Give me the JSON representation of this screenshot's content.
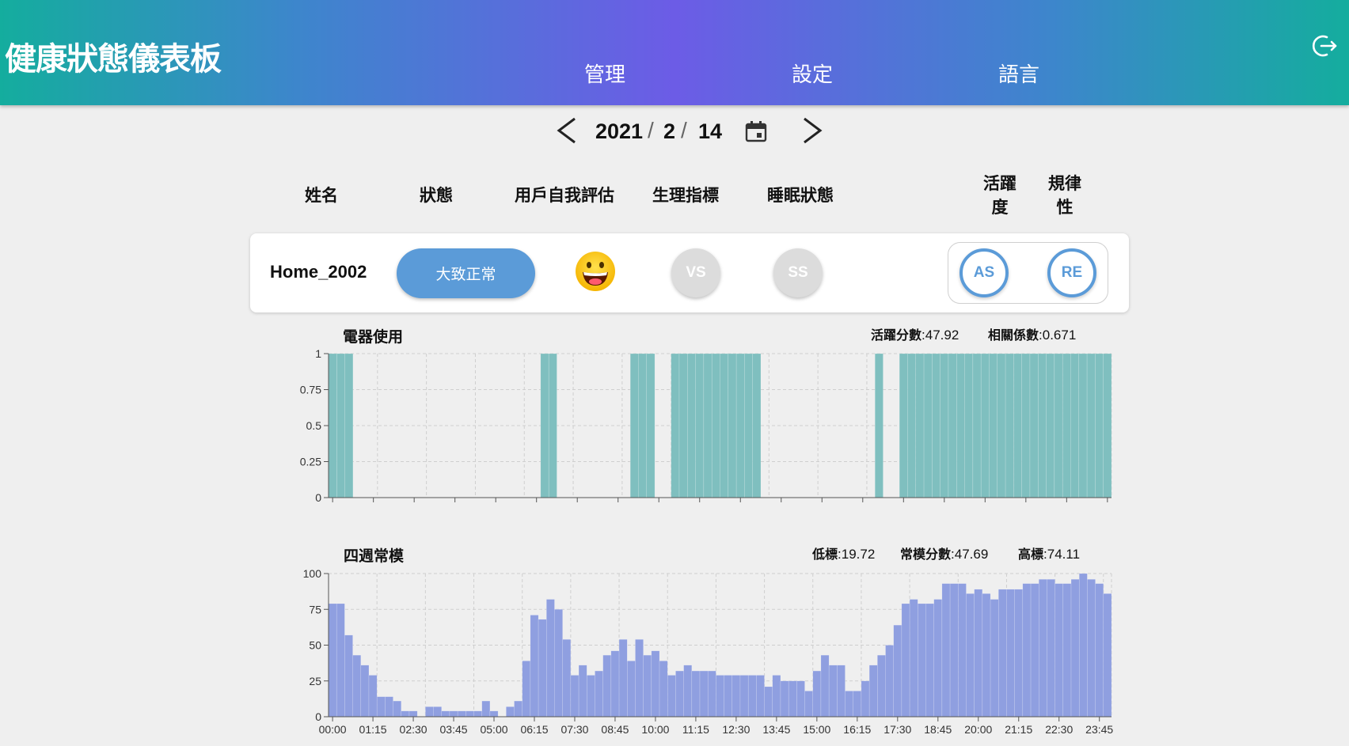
{
  "header": {
    "title": "健康狀態儀表板",
    "nav": [
      "管理",
      "設定",
      "語言"
    ],
    "logout_icon": "logout-icon"
  },
  "date": {
    "year": "2021",
    "month": "2",
    "day": "14",
    "sep": "/",
    "prev_icon": "chevron-left-icon",
    "next_icon": "chevron-right-icon",
    "calendar_icon": "calendar-icon"
  },
  "columns": {
    "name": "姓名",
    "status": "狀態",
    "self_eval": "用戶自我評估",
    "vital": "生理指標",
    "sleep": "睡眠狀態",
    "activity_1": "活躍",
    "activity_2": "度",
    "regularity_1": "規律",
    "regularity_2": "性"
  },
  "user": {
    "name": "Home_2002",
    "status": "大致正常",
    "self_eval_icon": "grinning-face-icon",
    "vs": "VS",
    "ss": "SS",
    "as": "AS",
    "re": "RE",
    "colors": {
      "status": "#5b9bd8",
      "ring": "#5b9bd8",
      "disabled": "#dcdcdc"
    }
  },
  "appliance": {
    "title": "電器使用",
    "activity_label": "活躍分數",
    "activity_value": "47.92",
    "corr_label": "相關係數",
    "corr_value": "0.671"
  },
  "routine": {
    "title": "四週常模",
    "low_label": "低標",
    "low_value": "19.72",
    "routine_label": "常模分數",
    "routine_value": "47.69",
    "high_label": "高標",
    "high_value": "74.11"
  },
  "chart_data": [
    {
      "type": "bar",
      "name": "appliance-usage",
      "title": "電器使用",
      "ylim": [
        0,
        1
      ],
      "yticks": [
        "0",
        "0.25",
        "0.5",
        "0.75",
        "1"
      ],
      "bins": 96,
      "color": "#7fbfbf",
      "on_intervals": [
        [
          0,
          3
        ],
        [
          26,
          28
        ],
        [
          37,
          40
        ],
        [
          42,
          53
        ],
        [
          67,
          68
        ],
        [
          70,
          96
        ]
      ]
    },
    {
      "type": "bar",
      "name": "four-week-routine",
      "title": "四週常模",
      "ylim": [
        0,
        100
      ],
      "yticks": [
        "0",
        "25",
        "50",
        "75",
        "100"
      ],
      "color": "#8f9fe0",
      "xticks": [
        "00:00",
        "01:15",
        "02:30",
        "03:45",
        "05:00",
        "06:15",
        "07:30",
        "08:45",
        "10:00",
        "11:15",
        "12:30",
        "13:45",
        "15:00",
        "16:15",
        "17:30",
        "18:45",
        "20:00",
        "21:15",
        "22:30",
        "23:45"
      ],
      "values": [
        79,
        79,
        57,
        43,
        36,
        29,
        14,
        14,
        11,
        4,
        4,
        0,
        7,
        7,
        4,
        4,
        4,
        4,
        4,
        11,
        4,
        0,
        7,
        11,
        39,
        71,
        68,
        82,
        75,
        54,
        29,
        36,
        29,
        32,
        43,
        46,
        54,
        39,
        54,
        43,
        46,
        39,
        29,
        32,
        36,
        32,
        32,
        32,
        29,
        29,
        29,
        29,
        29,
        29,
        21,
        29,
        25,
        25,
        25,
        18,
        32,
        43,
        36,
        36,
        18,
        18,
        25,
        36,
        43,
        50,
        64,
        79,
        82,
        79,
        79,
        82,
        93,
        93,
        93,
        86,
        89,
        86,
        82,
        89,
        89,
        89,
        93,
        93,
        96,
        96,
        93,
        93,
        96,
        100,
        96,
        93,
        86
      ]
    }
  ]
}
